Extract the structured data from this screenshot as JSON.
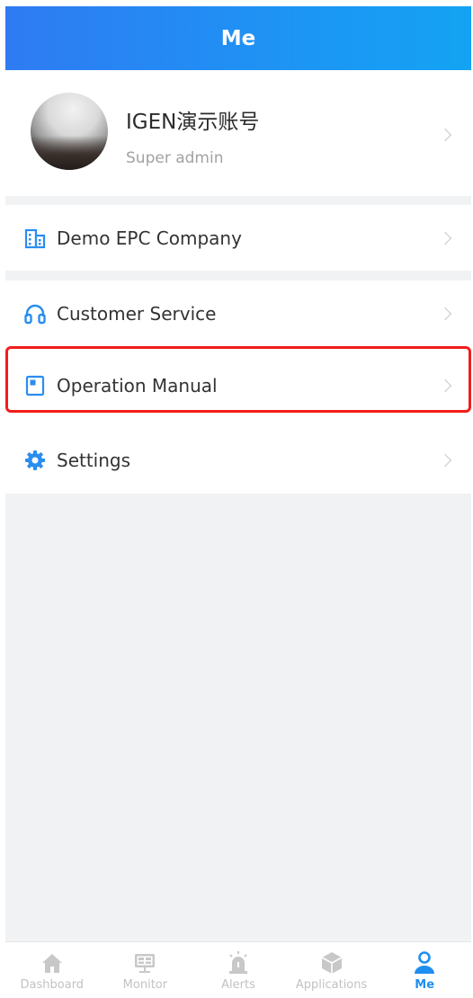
{
  "header": {
    "title": "Me"
  },
  "profile": {
    "name": "IGEN演示账号",
    "role": "Super admin"
  },
  "company": {
    "label": "Demo EPC Company",
    "icon": "building-icon"
  },
  "menu": {
    "items": [
      {
        "label": "Customer Service",
        "icon": "headset-icon"
      },
      {
        "label": "Operation Manual",
        "icon": "book-icon"
      },
      {
        "label": "Settings",
        "icon": "gear-icon"
      }
    ]
  },
  "tabs": [
    {
      "label": "Dashboard",
      "icon": "home-icon",
      "active": false
    },
    {
      "label": "Monitor",
      "icon": "monitor-icon",
      "active": false
    },
    {
      "label": "Alerts",
      "icon": "alarm-icon",
      "active": false
    },
    {
      "label": "Applications",
      "icon": "cube-icon",
      "active": false
    },
    {
      "label": "Me",
      "icon": "person-icon",
      "active": true
    }
  ],
  "colors": {
    "accent": "#1f8ef1",
    "header_start": "#2f7bf2",
    "header_end": "#13a3f3",
    "highlight": "#f21c1c",
    "inactive_tab": "#c2c2c2"
  }
}
